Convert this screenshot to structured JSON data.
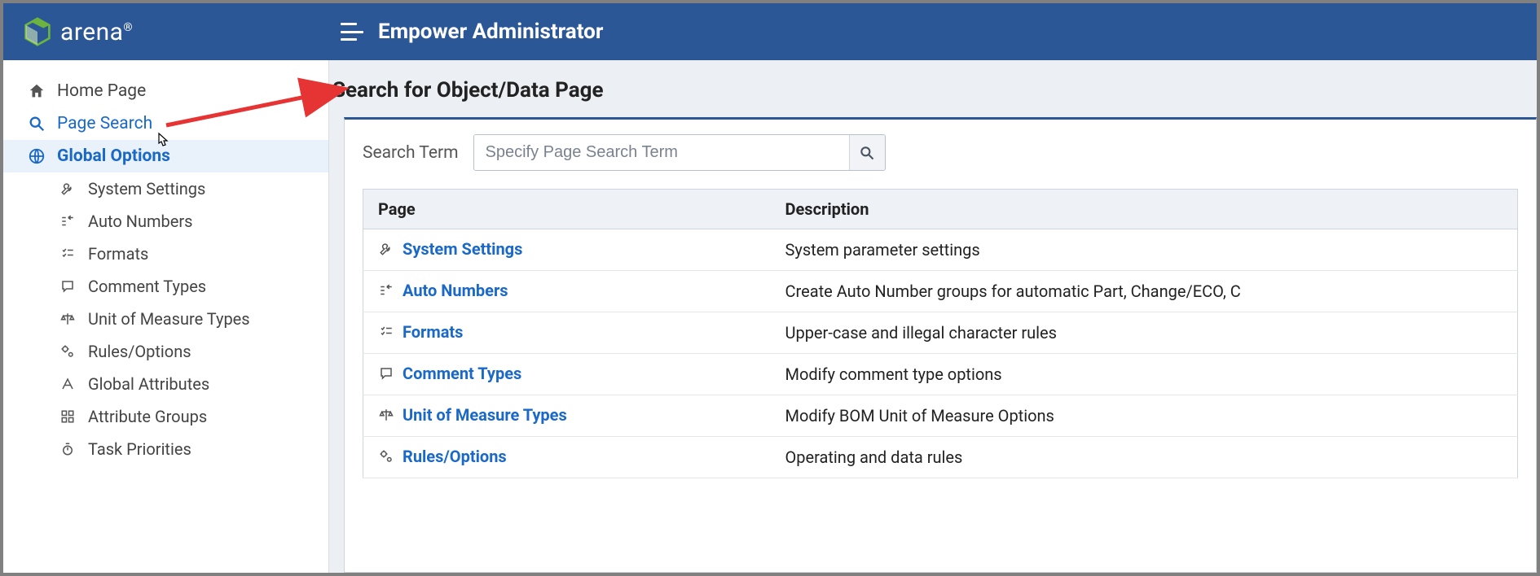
{
  "header": {
    "brand": "arena",
    "title": "Empower Administrator"
  },
  "sidebar": {
    "home": "Home Page",
    "page_search": "Page Search",
    "global_options": "Global Options",
    "children": {
      "system_settings": "System Settings",
      "auto_numbers": "Auto Numbers",
      "formats": "Formats",
      "comment_types": "Comment Types",
      "uom_types": "Unit of Measure Types",
      "rules_options": "Rules/Options",
      "global_attributes": "Global Attributes",
      "attribute_groups": "Attribute Groups",
      "task_priorities": "Task Priorities"
    }
  },
  "main": {
    "page_title": "Search for Object/Data Page",
    "search_label": "Search Term",
    "search_placeholder": "Specify Page Search Term",
    "columns": {
      "page": "Page",
      "description": "Description"
    },
    "rows": [
      {
        "page": "System Settings",
        "desc": "System parameter settings"
      },
      {
        "page": "Auto Numbers",
        "desc": "Create Auto Number groups for automatic Part, Change/ECO, C"
      },
      {
        "page": "Formats",
        "desc": "Upper-case and illegal character rules"
      },
      {
        "page": "Comment Types",
        "desc": "Modify comment type options"
      },
      {
        "page": "Unit of Measure Types",
        "desc": "Modify BOM Unit of Measure Options"
      },
      {
        "page": "Rules/Options",
        "desc": "Operating and data rules"
      }
    ]
  }
}
